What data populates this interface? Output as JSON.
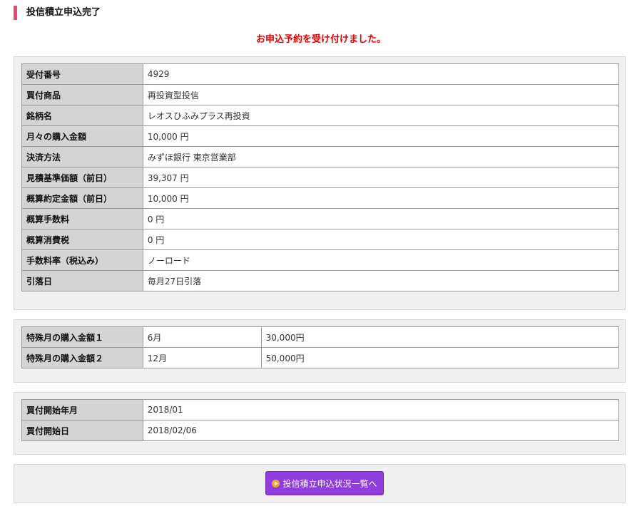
{
  "page": {
    "title": "投信積立申込完了",
    "notice": "お申込予約を受け付けました。"
  },
  "details": {
    "rows": [
      {
        "label": "受付番号",
        "value": "4929"
      },
      {
        "label": "買付商品",
        "value": "再投資型投信"
      },
      {
        "label": "銘柄名",
        "value": "レオスひふみプラス再投資"
      },
      {
        "label": "月々の購入金額",
        "value": "10,000 円"
      },
      {
        "label": "決済方法",
        "value": "みずほ銀行 東京営業部"
      },
      {
        "label": "見積基準価額（前日）",
        "value": "39,307 円"
      },
      {
        "label": "概算約定金額（前日）",
        "value": "10,000 円"
      },
      {
        "label": "概算手数料",
        "value": "0 円"
      },
      {
        "label": "概算消費税",
        "value": "0 円"
      },
      {
        "label": "手数料率（税込み）",
        "value": "ノーロード"
      },
      {
        "label": "引落日",
        "value": "毎月27日引落"
      }
    ]
  },
  "special": {
    "rows": [
      {
        "label": "特殊月の購入金額１",
        "month": "6月",
        "amount": "30,000円"
      },
      {
        "label": "特殊月の購入金額２",
        "month": "12月",
        "amount": "50,000円"
      }
    ]
  },
  "start": {
    "rows": [
      {
        "label": "買付開始年月",
        "value": "2018/01"
      },
      {
        "label": "買付開始日",
        "value": "2018/02/06"
      }
    ]
  },
  "actions": {
    "status_list_label": "投信積立申込状況一覧へ",
    "button_color": "#8f3ddc"
  }
}
